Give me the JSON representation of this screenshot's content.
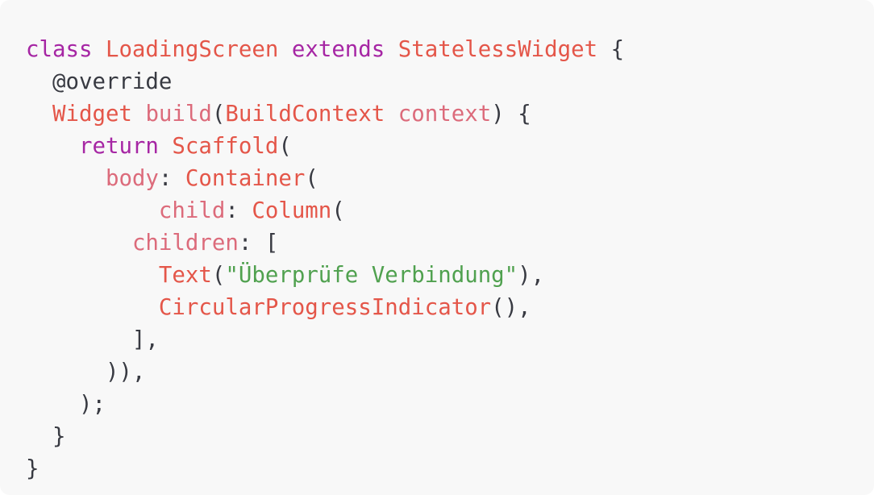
{
  "code": {
    "colors": {
      "background": "#f8f8f8",
      "keyword": "#a626a4",
      "type": "#e45649",
      "property": "#dc6b7b",
      "string": "#50a14f",
      "plain": "#383a42"
    },
    "lines": [
      [
        {
          "t": "class",
          "c": "kw"
        },
        {
          "t": " ",
          "c": "pl"
        },
        {
          "t": "LoadingScreen",
          "c": "ty"
        },
        {
          "t": " ",
          "c": "pl"
        },
        {
          "t": "extends",
          "c": "kw"
        },
        {
          "t": " ",
          "c": "pl"
        },
        {
          "t": "StatelessWidget",
          "c": "ty"
        },
        {
          "t": " {",
          "c": "pl"
        }
      ],
      [
        {
          "t": "  @override",
          "c": "pl"
        }
      ],
      [
        {
          "t": "  ",
          "c": "pl"
        },
        {
          "t": "Widget",
          "c": "ty"
        },
        {
          "t": " ",
          "c": "pl"
        },
        {
          "t": "build",
          "c": "pr"
        },
        {
          "t": "(",
          "c": "pl"
        },
        {
          "t": "BuildContext",
          "c": "ty"
        },
        {
          "t": " ",
          "c": "pl"
        },
        {
          "t": "context",
          "c": "pr"
        },
        {
          "t": ") {",
          "c": "pl"
        }
      ],
      [
        {
          "t": "    ",
          "c": "pl"
        },
        {
          "t": "return",
          "c": "kw"
        },
        {
          "t": " ",
          "c": "pl"
        },
        {
          "t": "Scaffold",
          "c": "ty"
        },
        {
          "t": "(",
          "c": "pl"
        }
      ],
      [
        {
          "t": "      ",
          "c": "pl"
        },
        {
          "t": "body",
          "c": "pr"
        },
        {
          "t": ": ",
          "c": "pl"
        },
        {
          "t": "Container",
          "c": "ty"
        },
        {
          "t": "(",
          "c": "pl"
        }
      ],
      [
        {
          "t": "          ",
          "c": "pl"
        },
        {
          "t": "child",
          "c": "pr"
        },
        {
          "t": ": ",
          "c": "pl"
        },
        {
          "t": "Column",
          "c": "ty"
        },
        {
          "t": "(",
          "c": "pl"
        }
      ],
      [
        {
          "t": "        ",
          "c": "pl"
        },
        {
          "t": "children",
          "c": "pr"
        },
        {
          "t": ": [",
          "c": "pl"
        }
      ],
      [
        {
          "t": "          ",
          "c": "pl"
        },
        {
          "t": "Text",
          "c": "ty"
        },
        {
          "t": "(",
          "c": "pl"
        },
        {
          "t": "\"Überprüfe Verbindung\"",
          "c": "st"
        },
        {
          "t": "),",
          "c": "pl"
        }
      ],
      [
        {
          "t": "          ",
          "c": "pl"
        },
        {
          "t": "CircularProgressIndicator",
          "c": "ty"
        },
        {
          "t": "(),",
          "c": "pl"
        }
      ],
      [
        {
          "t": "        ],",
          "c": "pl"
        }
      ],
      [
        {
          "t": "      )),",
          "c": "pl"
        }
      ],
      [
        {
          "t": "    );",
          "c": "pl"
        }
      ],
      [
        {
          "t": "  }",
          "c": "pl"
        }
      ],
      [
        {
          "t": "}",
          "c": "pl"
        }
      ]
    ]
  }
}
